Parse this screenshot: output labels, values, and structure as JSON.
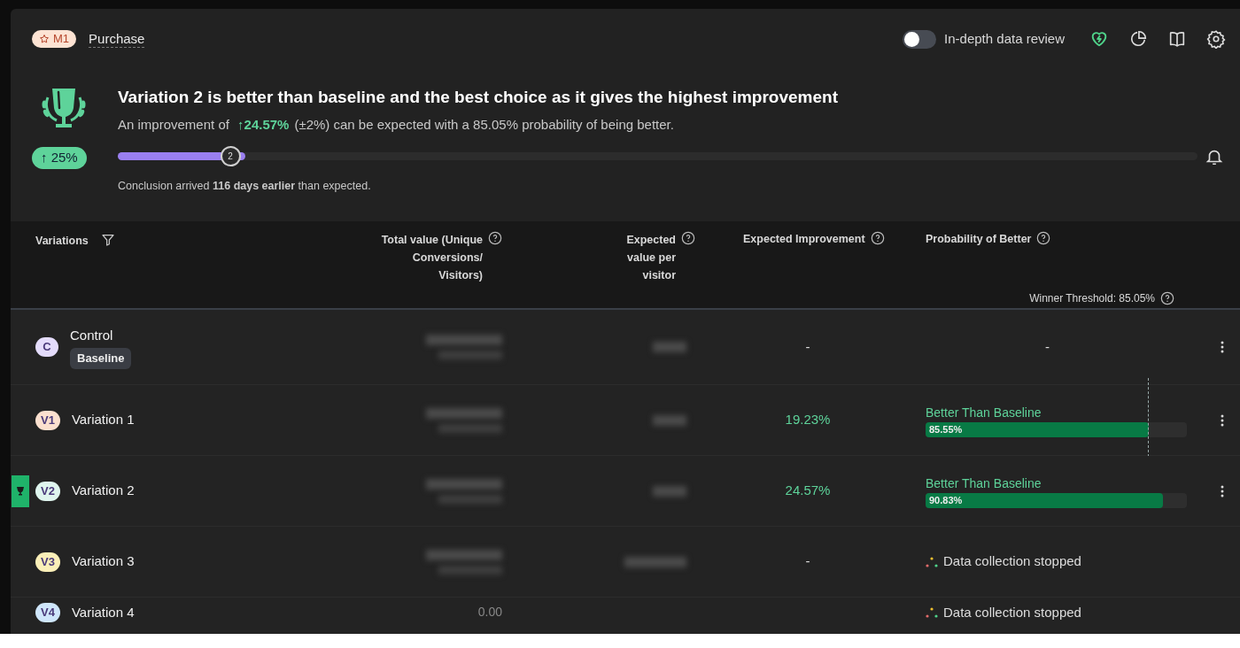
{
  "metric": {
    "badge": "M1",
    "name": "Purchase"
  },
  "toolbar": {
    "toggle": {
      "label": "In-depth data review",
      "on": false
    }
  },
  "summary": {
    "badge": "↑ 25%",
    "headline": "Variation 2 is better than baseline and the best choice as it gives the highest improvement",
    "improvement_prefix": "An improvement of",
    "improvement_value": "↑24.57%",
    "improvement_suffix": "(±2%) can be expected with a 85.05% probability of being better.",
    "progress": {
      "level": 0.118,
      "marker": "2"
    },
    "conclusion": "Conclusion arrived **116 days earlier** than expected."
  },
  "table": {
    "columns": [
      {
        "label": "Variations",
        "kind": "filter"
      },
      {
        "label": "Total value (Unique Conversions/ Visitors)",
        "kind": "help"
      },
      {
        "label": "Expected value per visitor",
        "kind": "help"
      },
      {
        "label": "Expected Improvement",
        "kind": "help"
      },
      {
        "label": "Probability of Better",
        "kind": "help"
      }
    ],
    "winner_threshold": {
      "label": "Winner Threshold: 85.05%",
      "level": 0.8505
    },
    "rows": [
      {
        "badge": "C",
        "color": "#e4dcfb",
        "name": "Control",
        "tag": "Baseline",
        "winner": false,
        "expected_improvement": "-",
        "probability": {
          "kind": "dash",
          "text": "-"
        }
      },
      {
        "badge": "V1",
        "color": "#fbe0cf",
        "name": "Variation 1",
        "winner": false,
        "expected_improvement": "19.23%",
        "probability": {
          "kind": "bar",
          "label": "Better Than Baseline",
          "value": "85.55%",
          "level": 0.8555
        }
      },
      {
        "badge": "V2",
        "color": "#dff5ee",
        "name": "Variation 2",
        "winner": true,
        "expected_improvement": "24.57%",
        "probability": {
          "kind": "bar",
          "label": "Better Than Baseline",
          "value": "90.83%",
          "level": 0.9083
        }
      },
      {
        "badge": "V3",
        "color": "#fbefb8",
        "name": "Variation 3",
        "winner": false,
        "expected_improvement": "-",
        "probability": {
          "kind": "stopped",
          "text": "Data collection stopped"
        }
      },
      {
        "badge": "V4",
        "color": "#cfe6fb",
        "name": "Variation 4",
        "winner": false,
        "total_value": "0.00",
        "probability": {
          "kind": "stopped",
          "text": "Data collection stopped"
        }
      }
    ]
  }
}
